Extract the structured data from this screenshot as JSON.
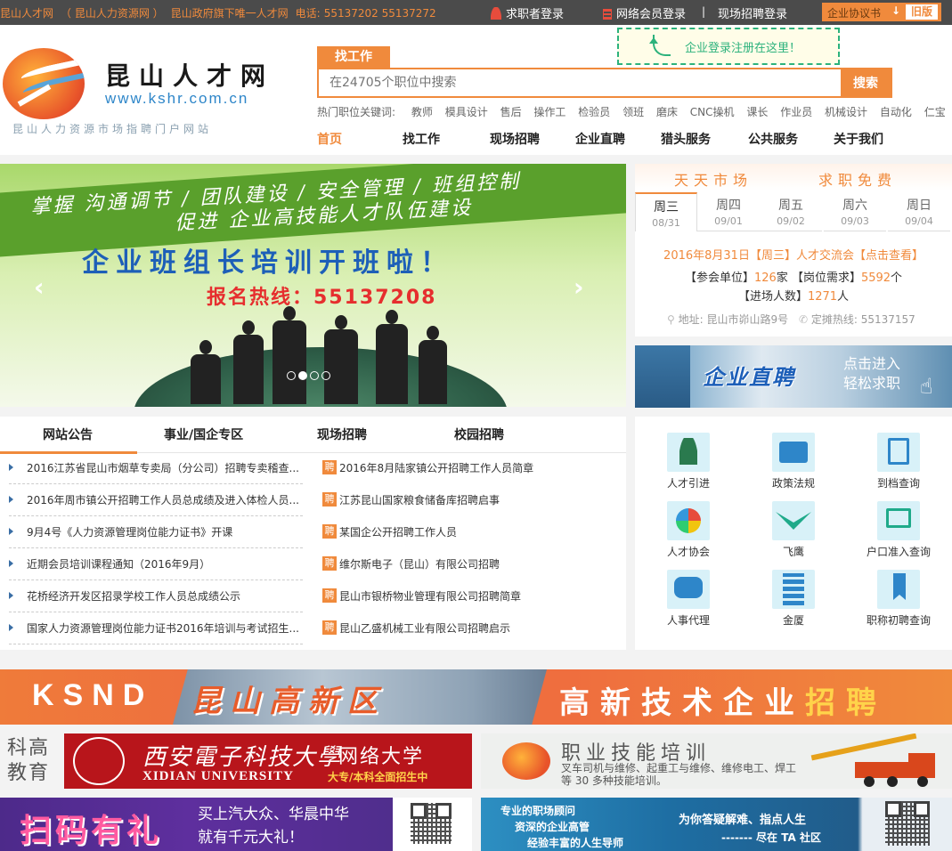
{
  "colors": {
    "accent": "#f08a3c",
    "topbar_bg": "#4b4b4b",
    "link_blue": "#2e86c9"
  },
  "topbar": {
    "site": "昆山人才网",
    "hr_site": "（ 昆山人力资源网 ）",
    "gov": "昆山政府旗下唯一人才网",
    "phone_label": "电话:",
    "phones": "55137202 55137272",
    "seeker_login": "求职者登录",
    "member_login": "网络会员登录",
    "separator": "|",
    "onsite_login": "现场招聘登录",
    "agreement": "企业协议书",
    "agreement_arrow": "↓",
    "old_version": "旧版"
  },
  "logo": {
    "title": "昆山人才网",
    "url": "www.kshr.com.cn",
    "slogan": "昆山人力资源市场指聘门户网站"
  },
  "hint": "企业登录注册在这里！",
  "search": {
    "tab": "找工作",
    "placeholder": "在24705个职位中搜索",
    "button": "搜索",
    "hot_label": "热门职位关键词:",
    "hot_words": [
      "教师",
      "模具设计",
      "售后",
      "操作工",
      "检验员",
      "领班",
      "磨床",
      "CNC操机",
      "课长",
      "作业员",
      "机械设计",
      "自动化",
      "仁宝"
    ]
  },
  "nav": [
    "首页",
    "找工作",
    "现场招聘",
    "企业直聘",
    "猎头服务",
    "公共服务",
    "关于我们"
  ],
  "banner": {
    "line1": "掌握 沟通调节 / 团队建设 / 安全管理 / 班组控制",
    "line2": "促进 企业高技能人才队伍建设",
    "title": "企业班组长培训开班啦！",
    "hotline": "报名热线：55137208",
    "prev": "‹",
    "next": "›"
  },
  "market": {
    "head_left": "天天市场",
    "head_right": "求职免费",
    "days": [
      {
        "week": "周三",
        "date": "08/31"
      },
      {
        "week": "周四",
        "date": "09/01"
      },
      {
        "week": "周五",
        "date": "09/02"
      },
      {
        "week": "周六",
        "date": "09/03"
      },
      {
        "week": "周日",
        "date": "09/04"
      }
    ],
    "event": "2016年8月31日【周三】人才交流会【点击查看】",
    "units_label": "【参会单位】",
    "units": "126",
    "units_unit": "家",
    "posts_label": "【岗位需求】",
    "posts": "5592",
    "posts_unit": "个",
    "people_label": "【进场人数】",
    "people": "1271",
    "people_unit": "人",
    "address": "地址: 昆山市峁山路9号",
    "hotline": "定摊热线: 55137157"
  },
  "direct_ad": {
    "title": "企业直聘",
    "line1": "点击进入",
    "line2": "轻松求职"
  },
  "notice_tabs": [
    "网站公告",
    "事业/国企专区",
    "现场招聘",
    "校园招聘"
  ],
  "notices": [
    "2016江苏省昆山市烟草专卖局（分公司）招聘专卖稽查...",
    "2016年周市镇公开招聘工作人员总成绩及进入体检人员...",
    "9月4号《人力资源管理岗位能力证书》开课",
    "近期会员培训课程通知（2016年9月）",
    "花桥经济开发区招录学校工作人员总成绩公示",
    "国家人力资源管理岗位能力证书2016年培训与考试招生..."
  ],
  "recruit_badge": "聘",
  "recruits": [
    "2016年8月陆家镇公开招聘工作人员简章",
    "江苏昆山国家粮食储备库招聘启事",
    "某国企公开招聘工作人员",
    "维尔斯电子（昆山）有限公司招聘",
    "昆山市银桥物业管理有限公司招聘简章",
    "昆山乙盛机械工业有限公司招聘启示"
  ],
  "services": [
    "人才引进",
    "政策法规",
    "到档查询",
    "人才协会",
    "飞鹰",
    "户口准入查询",
    "人事代理",
    "金厦",
    "职称初聘查询"
  ],
  "ads": {
    "ksnd": {
      "t1": "KSND",
      "t2": "昆山高新区",
      "t3a": "高新技术企业",
      "t3b": "招聘"
    },
    "xidian": {
      "side": "科高教育",
      "cn": "西安電子科技大學",
      "en": "XIDIAN UNIVERSITY",
      "net": "网络大学",
      "rec": "大专/本科全面招生中"
    },
    "skill": {
      "t1": "职业技能培训",
      "t2": "叉车司机与维修、起重工与维修、维修电工、焊工等 30 多种技能培训。"
    },
    "scan": {
      "t1": "扫码有礼",
      "t2a": "买上汽大众、华晨中华",
      "t2b": "就有千元大礼！"
    },
    "career": {
      "tag": "专业的职场顾问",
      "t2": "资深的企业高管",
      "t3": "经验丰富的人生导师",
      "t4": "为你答疑解难、指点人生",
      "t5": "------- 尽在 TA 社区"
    }
  }
}
